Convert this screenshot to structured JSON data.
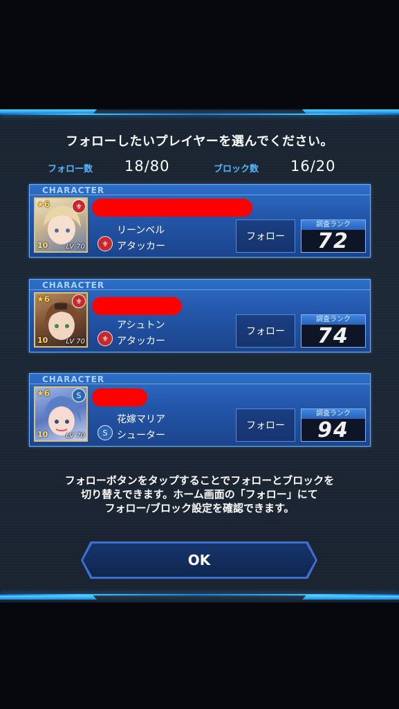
{
  "header": {
    "title": "フォローしたいプレイヤーを選んでください。",
    "follow_label": "フォロー数",
    "follow_value": "18/80",
    "block_label": "ブロック数",
    "block_value": "16/20"
  },
  "cards": [
    {
      "category": "CHARACTER",
      "star": "6",
      "level_prefix": "10",
      "level": "LV 70",
      "character": "リーンベル",
      "type": "アタッカー",
      "type_icon": "attacker-icon",
      "follow_label": "フォロー",
      "rank_label": "調査ランク",
      "rank": "72",
      "portrait_color": "#d9c9a4",
      "badge_color": "#c8282a"
    },
    {
      "category": "CHARACTER",
      "star": "6",
      "level_prefix": "10",
      "level": "LV 70",
      "character": "アシュトン",
      "type": "アタッカー",
      "type_icon": "attacker-icon",
      "follow_label": "フォロー",
      "rank_label": "調査ランク",
      "rank": "74",
      "portrait_color": "#8a5a3a",
      "badge_color": "#c8282a"
    },
    {
      "category": "CHARACTER",
      "star": "6",
      "level_prefix": "10",
      "level": "LV 70",
      "character": "花嫁マリア",
      "type": "シューター",
      "type_icon": "shooter-icon",
      "follow_label": "フォロー",
      "rank_label": "調査ランク",
      "rank": "94",
      "portrait_color": "#6a8cc8",
      "badge_color": "#2a66b8"
    }
  ],
  "info_lines": [
    "フォローボタンをタップすることでフォローとブロックを",
    "切り替えできます。ホーム画面の「フォロー」にて",
    "フォロー/ブロック設定を確認できます。"
  ],
  "ok_label": "OK"
}
